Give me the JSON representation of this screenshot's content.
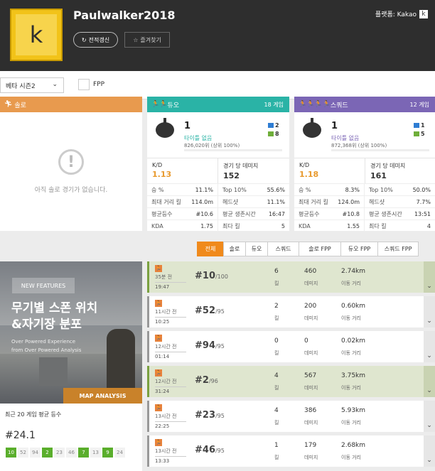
{
  "profile": {
    "username": "Paulwalker2018",
    "avatar_letter": "k",
    "platform_label": "플랫폼: Kakao",
    "platform_icon": "k",
    "refresh_label": "전적갱신",
    "favorite_label": "즐겨찾기"
  },
  "filters": {
    "season": "베타 시즌2",
    "fpp_label": "FPP"
  },
  "solo": {
    "title": "솔로",
    "empty_text": "아직 솔로 경기가 없습니다."
  },
  "duo": {
    "title": "듀오",
    "games": "18 게임",
    "rank": "1",
    "title_text": "타이틀 없음",
    "points": "826,020위 (상위 100%)",
    "mini1": "2",
    "mini2": "8",
    "kd_label": "K/D",
    "kd": "1.13",
    "dmg_label": "경기 당 데미지",
    "dmg": "152",
    "rows": [
      [
        "승 %",
        "11.1%",
        "Top 10%",
        "55.6%"
      ],
      [
        "최대 거리 킬",
        "114.0m",
        "헤드샷",
        "11.1%"
      ],
      [
        "평균등수",
        "#10.6",
        "평균 생존시간",
        "16:47"
      ],
      [
        "KDA",
        "1.75",
        "최다 킬",
        "5"
      ]
    ]
  },
  "squad": {
    "title": "스쿼드",
    "games": "12 게임",
    "rank": "1",
    "title_text": "타이틀 없음",
    "points": "872,368위 (상위 100%)",
    "mini1": "1",
    "mini2": "5",
    "kd_label": "K/D",
    "kd": "1.18",
    "dmg_label": "경기 당 데미지",
    "dmg": "161",
    "rows": [
      [
        "승 %",
        "8.3%",
        "Top 10%",
        "50.0%"
      ],
      [
        "최대 거리 킬",
        "124.0m",
        "헤드샷",
        "7.7%"
      ],
      [
        "평균등수",
        "#10.8",
        "평균 생존시간",
        "13:51"
      ],
      [
        "KDA",
        "1.55",
        "최다 킬",
        "4"
      ]
    ]
  },
  "tabs": [
    "전체",
    "솔로",
    "듀오",
    "스쿼드",
    "솔로 FPP",
    "듀오 FPP",
    "스쿼드 FPP"
  ],
  "promo": {
    "badge": "NEW FEATURES",
    "headline1": "무기별 스폰 위치",
    "headline2": "&자기장 분포",
    "sub1": "Over Powered Experience",
    "sub2": "from Over Powered Analysis",
    "button": "MAP ANALYSIS"
  },
  "average": {
    "label": "최근 20 게임 평균 등수",
    "value": "#24.1",
    "chips": [
      "10",
      "52",
      "94",
      "2",
      "23",
      "46",
      "7",
      "13",
      "9",
      "24"
    ]
  },
  "match_labels": {
    "kills": "킬",
    "damage": "데미지",
    "distance": "이동 거리"
  },
  "matches": [
    {
      "ago": "35분 전",
      "time": "19:47",
      "place": "#10",
      "total": "/100",
      "kills": "6",
      "damage": "460",
      "distance": "2.74km",
      "win": true
    },
    {
      "ago": "11시간 전",
      "time": "10:25",
      "place": "#52",
      "total": "/95",
      "kills": "2",
      "damage": "200",
      "distance": "0.60km",
      "win": false
    },
    {
      "ago": "12시간 전",
      "time": "01:14",
      "place": "#94",
      "total": "/95",
      "kills": "0",
      "damage": "0",
      "distance": "0.02km",
      "win": false
    },
    {
      "ago": "12시간 전",
      "time": "31:24",
      "place": "#2",
      "total": "/96",
      "kills": "4",
      "damage": "567",
      "distance": "3.75km",
      "win": true
    },
    {
      "ago": "13시간 전",
      "time": "22:25",
      "place": "#23",
      "total": "/95",
      "kills": "4",
      "damage": "386",
      "distance": "5.93km",
      "win": false
    },
    {
      "ago": "13시간 전",
      "time": "13:33",
      "place": "#46",
      "total": "/95",
      "kills": "1",
      "damage": "179",
      "distance": "2.68km",
      "win": false
    }
  ]
}
